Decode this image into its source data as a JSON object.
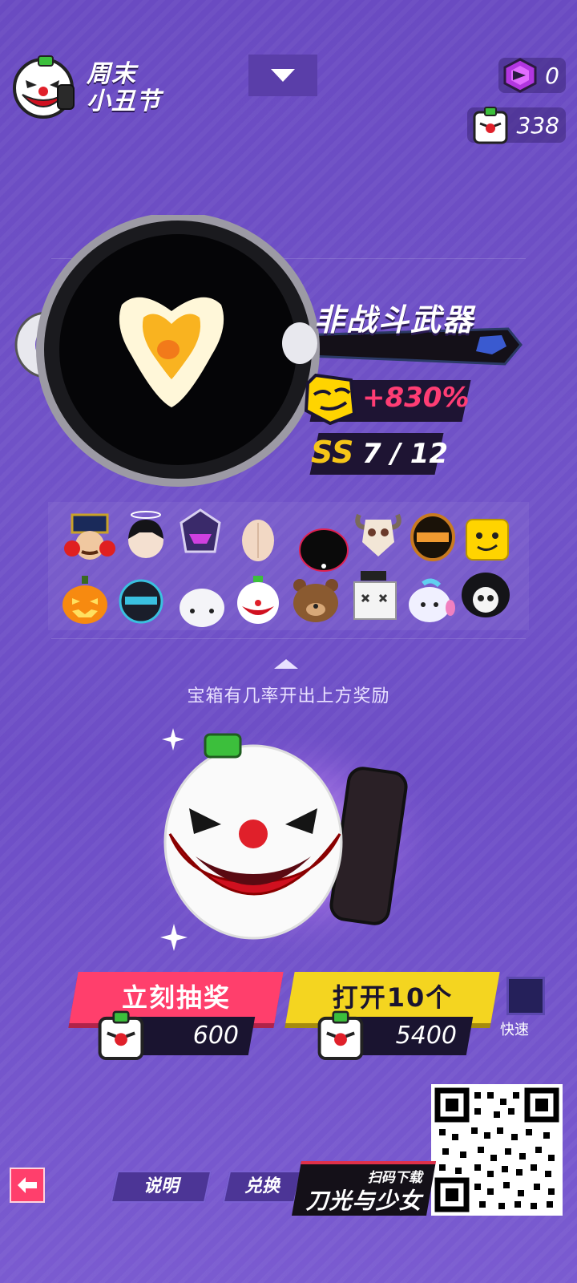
{
  "header": {
    "event_title": "周末小丑节",
    "event_title_line1": "周末",
    "event_title_line2": "小丑节",
    "currencies": [
      {
        "icon": "purple-gem-icon",
        "value": "0"
      },
      {
        "icon": "clown-ticket-icon",
        "value": "338"
      }
    ]
  },
  "featured": {
    "weapon_name": "非战斗武器",
    "bonus": "+830%",
    "rank": "SS",
    "rank_count": "7 / 12"
  },
  "rewards": [
    "nutcracker-hat",
    "black-hair-halo",
    "purple-knight-helmet",
    "bald-wig",
    "black-blob-head",
    "horned-skull",
    "bronze-visor-helmet",
    "yellow-block-head",
    "pumpkin-head",
    "dark-knight-helmet",
    "white-ghost-head",
    "clown-head",
    "bear-head",
    "box-head",
    "fish-head",
    "skull-hood"
  ],
  "hint": "宝箱有几率开出上方奖励",
  "actions": {
    "draw_label": "立刻抽奖",
    "draw_price": "600",
    "open10_label": "打开10个",
    "open10_price": "5400",
    "quick_label": "快速"
  },
  "footer": {
    "explain_label": "说明",
    "exchange_label": "兑换",
    "promo_small": "扫码下载",
    "promo_big": "刀光与少女"
  },
  "colors": {
    "background": "#6a4bc2",
    "draw_button": "#ff3f6c",
    "open10_button": "#f4d520",
    "bonus": "#ff3d74",
    "rank": "#f5c518"
  }
}
